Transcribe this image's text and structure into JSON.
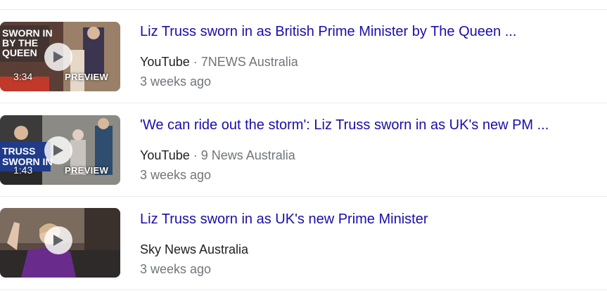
{
  "results": [
    {
      "title": "Liz Truss sworn in as British Prime Minister by The Queen ...",
      "source": "YouTube",
      "separator": "·",
      "channel": "7NEWS Australia",
      "age": "3 weeks ago",
      "duration": "3:34",
      "preview_label": "PREVIEW",
      "thumb_caption": [
        "SWORN IN",
        "BY THE",
        "QUEEN"
      ]
    },
    {
      "title": "'We can ride out the storm': Liz Truss sworn in as UK's new PM ...",
      "source": "YouTube",
      "separator": "·",
      "channel": "9 News Australia",
      "age": "3 weeks ago",
      "duration": "1:43",
      "preview_label": "PREVIEW",
      "thumb_caption": [
        "TRUSS",
        "SWORN IN"
      ]
    },
    {
      "title": "Liz Truss sworn in as UK's new Prime Minister",
      "source": "Sky News Australia",
      "age": "3 weeks ago"
    }
  ],
  "colors": {
    "link": "#1a0dab",
    "meta": "#70757a",
    "text": "#202124",
    "divider": "#ebebeb"
  },
  "icons": {
    "play": "play-icon"
  }
}
